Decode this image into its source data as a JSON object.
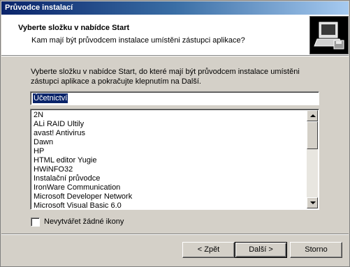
{
  "window": {
    "title": "Průvodce instalací"
  },
  "header": {
    "title": "Vyberte složku v nabídce Start",
    "subtitle": "Kam mají být průvodcem instalace umístěni zástupci aplikace?",
    "icon": "computer-install-icon"
  },
  "main": {
    "description": "Vyberte složku v nabídce Start, do které mají být průvodcem instalace umístěni zástupci aplikace a pokračujte klepnutím na Další.",
    "folder_input": {
      "value": "Účetnictví"
    },
    "folders": [
      "2N",
      "ALi RAID Ultily",
      "avast! Antivirus",
      "Dawn",
      "HP",
      "HTML editor Yugie",
      "HWiNFO32",
      "Instalační průvodce",
      "IronWare Communication",
      "Microsoft Developer Network",
      "Microsoft Visual Basic 6.0"
    ],
    "checkbox": {
      "label": "Nevytvářet žádné ikony",
      "checked": false
    }
  },
  "footer": {
    "back_label": "< Zpět",
    "next_label": "Další >",
    "cancel_label": "Storno"
  }
}
